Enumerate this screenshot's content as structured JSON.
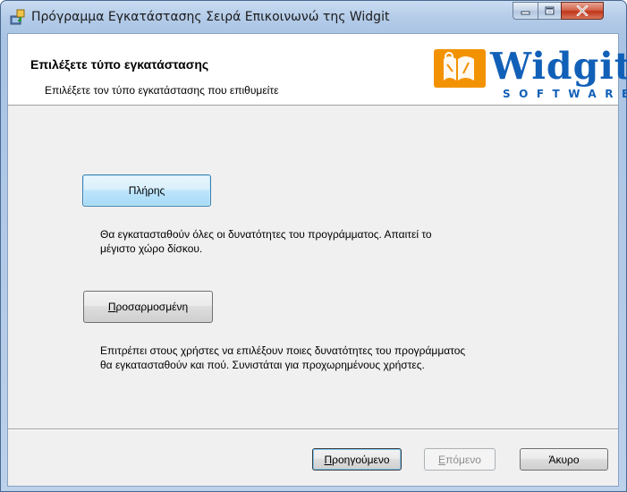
{
  "window": {
    "title": "Πρόγραμμα Εγκατάστασης Σειρά Επικοινωνώ της Widgit",
    "controls": {
      "minimize_icon": "minimize-icon",
      "maximize_icon": "maximize-icon",
      "close_icon": "close-icon"
    }
  },
  "header": {
    "title": "Επιλέξετε τύπο εγκατάστασης",
    "subtitle": "Επιλέξετε τον τύπο εγκατάστασης που επιθυμείτε",
    "logo": {
      "word": "Widgit",
      "sub": "SOFTWARE",
      "color": "#1160b8",
      "accent": "#f39200"
    }
  },
  "options": {
    "complete": {
      "label": "Πλήρης",
      "description_line1": "Θα εγκατασταθούν όλες οι δυνατότητες του προγράμματος. Απαιτεί το",
      "description_line2": "μέγιστο χώρο δίσκου."
    },
    "custom": {
      "label_mnemonic": "Π",
      "label_rest": "ροσαρμοσμένη",
      "description_line1": "Επιτρέπει στους χρήστες να επιλέξουν ποιες δυνατότητες του προγράμματος",
      "description_line2": "θα εγκατασταθούν και πού. Συνιστάται για προχωρημένους χρήστες."
    }
  },
  "footer": {
    "back_mnemonic": "Π",
    "back_rest": "ροηγούμενο",
    "next_mnemonic": "Ε",
    "next_rest": "πόμενο",
    "cancel": "Άκυρο"
  }
}
